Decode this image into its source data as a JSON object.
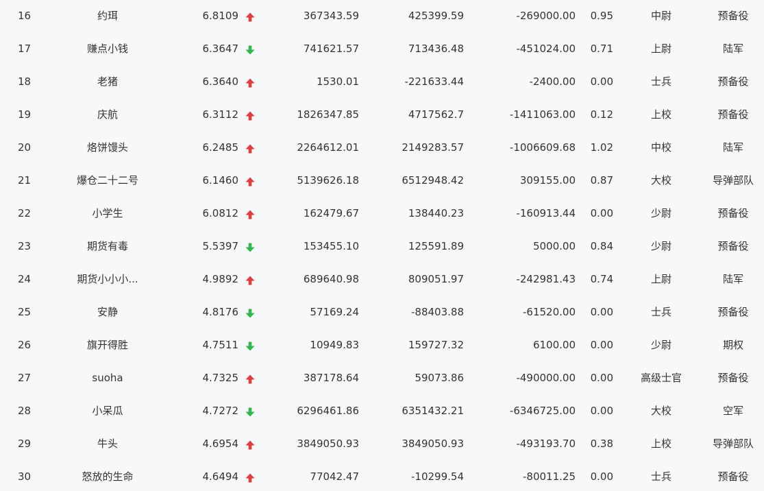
{
  "colors": {
    "up": "#e63b3b",
    "down": "#2db84d",
    "text": "#333333",
    "background": "#f7f8fa"
  },
  "rows": [
    {
      "rank": "16",
      "name": "约珥",
      "score": "6.8109",
      "trend": "up",
      "v1": "367343.59",
      "v2": "425399.59",
      "v3": "-269000.00",
      "ratio": "0.95",
      "title": "中尉",
      "branch": "预备役"
    },
    {
      "rank": "17",
      "name": "赚点小钱",
      "score": "6.3647",
      "trend": "down",
      "v1": "741621.57",
      "v2": "713436.48",
      "v3": "-451024.00",
      "ratio": "0.71",
      "title": "上尉",
      "branch": "陆军"
    },
    {
      "rank": "18",
      "name": "老猪",
      "score": "6.3640",
      "trend": "up",
      "v1": "1530.01",
      "v2": "-221633.44",
      "v3": "-2400.00",
      "ratio": "0.00",
      "title": "士兵",
      "branch": "预备役"
    },
    {
      "rank": "19",
      "name": "庆航",
      "score": "6.3112",
      "trend": "up",
      "v1": "1826347.85",
      "v2": "4717562.7",
      "v3": "-1411063.00",
      "ratio": "0.12",
      "title": "上校",
      "branch": "预备役"
    },
    {
      "rank": "20",
      "name": "烙饼馒头",
      "score": "6.2485",
      "trend": "up",
      "v1": "2264612.01",
      "v2": "2149283.57",
      "v3": "-1006609.68",
      "ratio": "1.02",
      "title": "中校",
      "branch": "陆军"
    },
    {
      "rank": "21",
      "name": "爆仓二十二号",
      "score": "6.1460",
      "trend": "up",
      "v1": "5139626.18",
      "v2": "6512948.42",
      "v3": "309155.00",
      "ratio": "0.87",
      "title": "大校",
      "branch": "导弹部队"
    },
    {
      "rank": "22",
      "name": "小学生",
      "score": "6.0812",
      "trend": "up",
      "v1": "162479.67",
      "v2": "138440.23",
      "v3": "-160913.44",
      "ratio": "0.00",
      "title": "少尉",
      "branch": "预备役"
    },
    {
      "rank": "23",
      "name": "期货有毒",
      "score": "5.5397",
      "trend": "down",
      "v1": "153455.10",
      "v2": "125591.89",
      "v3": "5000.00",
      "ratio": "0.84",
      "title": "少尉",
      "branch": "预备役"
    },
    {
      "rank": "24",
      "name": "期货小小小...",
      "score": "4.9892",
      "trend": "up",
      "v1": "689640.98",
      "v2": "809051.97",
      "v3": "-242981.43",
      "ratio": "0.74",
      "title": "上尉",
      "branch": "陆军"
    },
    {
      "rank": "25",
      "name": "安静",
      "score": "4.8176",
      "trend": "down",
      "v1": "57169.24",
      "v2": "-88403.88",
      "v3": "-61520.00",
      "ratio": "0.00",
      "title": "士兵",
      "branch": "预备役"
    },
    {
      "rank": "26",
      "name": "旗开得胜",
      "score": "4.7511",
      "trend": "down",
      "v1": "10949.83",
      "v2": "159727.32",
      "v3": "6100.00",
      "ratio": "0.00",
      "title": "少尉",
      "branch": "期权"
    },
    {
      "rank": "27",
      "name": "suoha",
      "score": "4.7325",
      "trend": "up",
      "v1": "387178.64",
      "v2": "59073.86",
      "v3": "-490000.00",
      "ratio": "0.00",
      "title": "高级士官",
      "branch": "预备役"
    },
    {
      "rank": "28",
      "name": "小呆瓜",
      "score": "4.7272",
      "trend": "down",
      "v1": "6296461.86",
      "v2": "6351432.21",
      "v3": "-6346725.00",
      "ratio": "0.00",
      "title": "大校",
      "branch": "空军"
    },
    {
      "rank": "29",
      "name": "牛头",
      "score": "4.6954",
      "trend": "up",
      "v1": "3849050.93",
      "v2": "3849050.93",
      "v3": "-493193.70",
      "ratio": "0.38",
      "title": "上校",
      "branch": "导弹部队"
    },
    {
      "rank": "30",
      "name": "怒放的生命",
      "score": "4.6494",
      "trend": "up",
      "v1": "77042.47",
      "v2": "-10299.54",
      "v3": "-80011.25",
      "ratio": "0.00",
      "title": "士兵",
      "branch": "预备役"
    }
  ]
}
